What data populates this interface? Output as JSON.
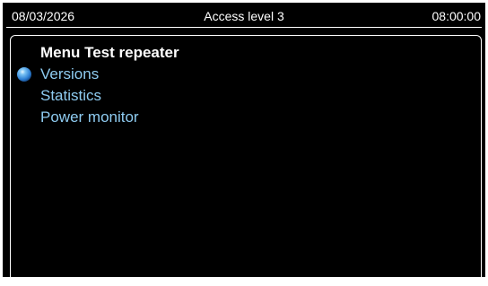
{
  "status_bar": {
    "date": "08/03/2026",
    "access_level": "Access level 3",
    "time": "08:00:00"
  },
  "menu": {
    "title": "Menu Test repeater",
    "selected_index": 0,
    "items": [
      {
        "label": "Versions"
      },
      {
        "label": "Statistics"
      },
      {
        "label": "Power monitor"
      }
    ]
  },
  "colors": {
    "background": "#000000",
    "text": "#ffffff",
    "menu_item": "#8ecbf0",
    "selection_bullet": "#3a8fe0"
  },
  "icons": {
    "selection": "blue-sphere-bullet"
  }
}
